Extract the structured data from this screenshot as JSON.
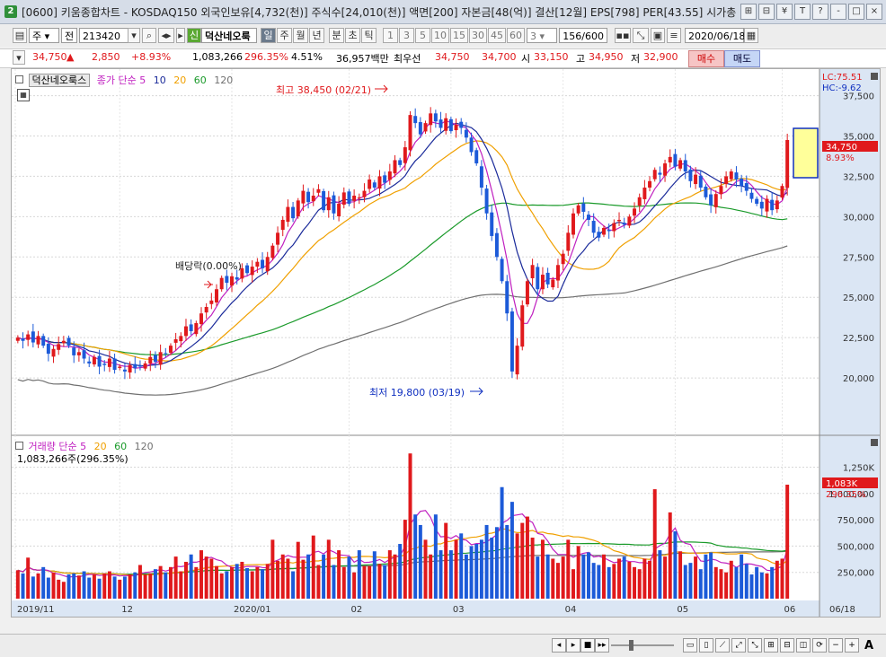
{
  "window": {
    "app_number": "2",
    "title": "[0600] 키움종합차트 - KOSDAQ150 외국인보유[4,732(천)] 주식수[24,010(천)] 액면[200] 자본금[48(억)] 결산[12월] EPS[798] PER[43.55] 시가총",
    "buttons": [
      "⊞",
      "⊟",
      "¥",
      "T",
      "?",
      "-",
      "□",
      "×"
    ]
  },
  "toolbar": {
    "market_type": "주",
    "prev_label": "전",
    "code": "213420",
    "badge_new": "신",
    "stock_name": "덕산네오룩",
    "periods": [
      "일",
      "주",
      "월",
      "년",
      "분",
      "초",
      "틱"
    ],
    "active_period": "일",
    "intervals": [
      "1",
      "3",
      "5",
      "10",
      "15",
      "30",
      "45",
      "60"
    ],
    "interval_value": "3",
    "count": "156/600",
    "date": "2020/06/18"
  },
  "quote": {
    "price": "34,750",
    "arrow": "▲",
    "change": "2,850",
    "change_pct": "+8.93%",
    "volume": "1,083,266",
    "volume_pct": "296.35%",
    "turnover": "4.51%",
    "amount": "36,957백만",
    "best_label": "최우선",
    "best_ask": "34,750",
    "best_bid": "34,700",
    "open_label": "시",
    "open": "33,150",
    "high_label": "고",
    "high": "34,950",
    "low_label": "저",
    "low": "32,900",
    "buy_label": "매수",
    "sell_label": "매도"
  },
  "price_panel": {
    "name_tag": "덕산네오룩스",
    "legend_prefix": "종가 단순",
    "ma": [
      "5",
      "10",
      "20",
      "60",
      "120"
    ],
    "lc": "LC:75.51",
    "hc": "HC:-9.62",
    "y_ticks": [
      "37,500",
      "35,000",
      "32,500",
      "30,000",
      "27,500",
      "25,000",
      "22,500",
      "20,000"
    ],
    "current_price": "34,750",
    "current_pct": "8.93%",
    "high_annotation": "최고 38,450 (02/21)",
    "low_annotation": "최저 19,800 (03/19)",
    "dividend_annotation": "배당락(0.00%)"
  },
  "volume_panel": {
    "legend_prefix": "거래량 단순",
    "ma": [
      "5",
      "20",
      "60",
      "120"
    ],
    "value_text": "1,083,266주(296.35%)",
    "y_ticks": [
      "1,250K",
      "1,000,000",
      "750,000",
      "500,000",
      "250,000"
    ],
    "current_value": "1,083K",
    "current_pct": "296.35%"
  },
  "x_axis": [
    "2019/11",
    "12",
    "2020/01",
    "02",
    "03",
    "04",
    "05",
    "06",
    "06/18"
  ],
  "colors": {
    "up": "#e0191c",
    "down": "#1c5ad8",
    "ma5": "#c020c0",
    "ma10": "#1a2a9a",
    "ma20": "#f0a000",
    "ma60": "#1a9a2a",
    "ma120": "#707070"
  },
  "chart_data": {
    "type": "candlestick",
    "start": "2019-11-04",
    "close": [
      22500,
      22300,
      22700,
      22200,
      22600,
      22000,
      21500,
      21800,
      22100,
      22300,
      22000,
      21400,
      21600,
      21200,
      20900,
      21300,
      20700,
      20800,
      21200,
      20500,
      20700,
      20400,
      20800,
      20600,
      20700,
      20900,
      21300,
      21000,
      21600,
      21500,
      22000,
      22400,
      22600,
      23200,
      22900,
      23400,
      24000,
      24400,
      24800,
      25500,
      26200,
      25900,
      26300,
      26100,
      26800,
      26500,
      26900,
      27200,
      26800,
      27500,
      28200,
      29000,
      29800,
      30600,
      29900,
      31000,
      31600,
      30900,
      31300,
      31700,
      30400,
      31200,
      30200,
      30800,
      31500,
      30800,
      31300,
      31200,
      31600,
      32300,
      31800,
      32500,
      32100,
      32800,
      33500,
      33200,
      34300,
      36300,
      35800,
      35100,
      35800,
      36400,
      35900,
      35500,
      36100,
      35300,
      35700,
      35500,
      34900,
      34000,
      33300,
      31800,
      30200,
      28800,
      27500,
      26000,
      24000,
      20400,
      22000,
      24500,
      26000,
      27000,
      25500,
      26400,
      25800,
      26100,
      27000,
      27700,
      29000,
      30200,
      30700,
      30300,
      29800,
      29000,
      28700,
      29300,
      29100,
      29600,
      29800,
      29500,
      30000,
      30500,
      31200,
      31800,
      32200,
      32900,
      32600,
      33300,
      33700,
      33100,
      33500,
      32800,
      32200,
      32600,
      31800,
      31200,
      30700,
      31400,
      31900,
      32500,
      32800,
      32300,
      31900,
      31600,
      31100,
      30800,
      30500,
      31100,
      30400,
      31000,
      31900,
      34750
    ],
    "volume": [
      270000,
      240000,
      390000,
      210000,
      240000,
      300000,
      200000,
      250000,
      180000,
      160000,
      230000,
      240000,
      220000,
      260000,
      200000,
      230000,
      190000,
      240000,
      260000,
      210000,
      180000,
      210000,
      230000,
      250000,
      320000,
      230000,
      240000,
      280000,
      310000,
      250000,
      300000,
      400000,
      260000,
      350000,
      420000,
      300000,
      460000,
      400000,
      380000,
      310000,
      240000,
      260000,
      300000,
      330000,
      350000,
      290000,
      260000,
      300000,
      280000,
      330000,
      560000,
      360000,
      420000,
      380000,
      260000,
      540000,
      370000,
      420000,
      600000,
      320000,
      420000,
      560000,
      320000,
      460000,
      300000,
      400000,
      250000,
      460000,
      310000,
      310000,
      450000,
      330000,
      320000,
      460000,
      420000,
      520000,
      750000,
      1380000,
      800000,
      700000,
      560000,
      420000,
      800000,
      460000,
      720000,
      460000,
      560000,
      620000,
      420000,
      500000,
      520000,
      560000,
      700000,
      580000,
      680000,
      1060000,
      700000,
      920000,
      620000,
      720000,
      780000,
      580000,
      400000,
      560000,
      420000,
      380000,
      340000,
      400000,
      560000,
      280000,
      500000,
      420000,
      440000,
      340000,
      320000,
      420000,
      300000,
      330000,
      380000,
      400000,
      350000,
      300000,
      280000,
      380000,
      360000,
      1040000,
      460000,
      400000,
      820000,
      640000,
      450000,
      320000,
      340000,
      400000,
      280000,
      420000,
      440000,
      300000,
      280000,
      250000,
      360000,
      300000,
      420000,
      330000,
      230000,
      300000,
      250000,
      240000,
      300000,
      360000,
      380000,
      1083266
    ],
    "y_price_range": [
      17000,
      38700
    ],
    "y_volume_range": [
      0,
      1450000
    ],
    "high": {
      "value": 38450,
      "date": "02/21"
    },
    "low": {
      "value": 19800,
      "date": "03/19"
    }
  },
  "bottom_bar": {
    "right_label": "A"
  }
}
